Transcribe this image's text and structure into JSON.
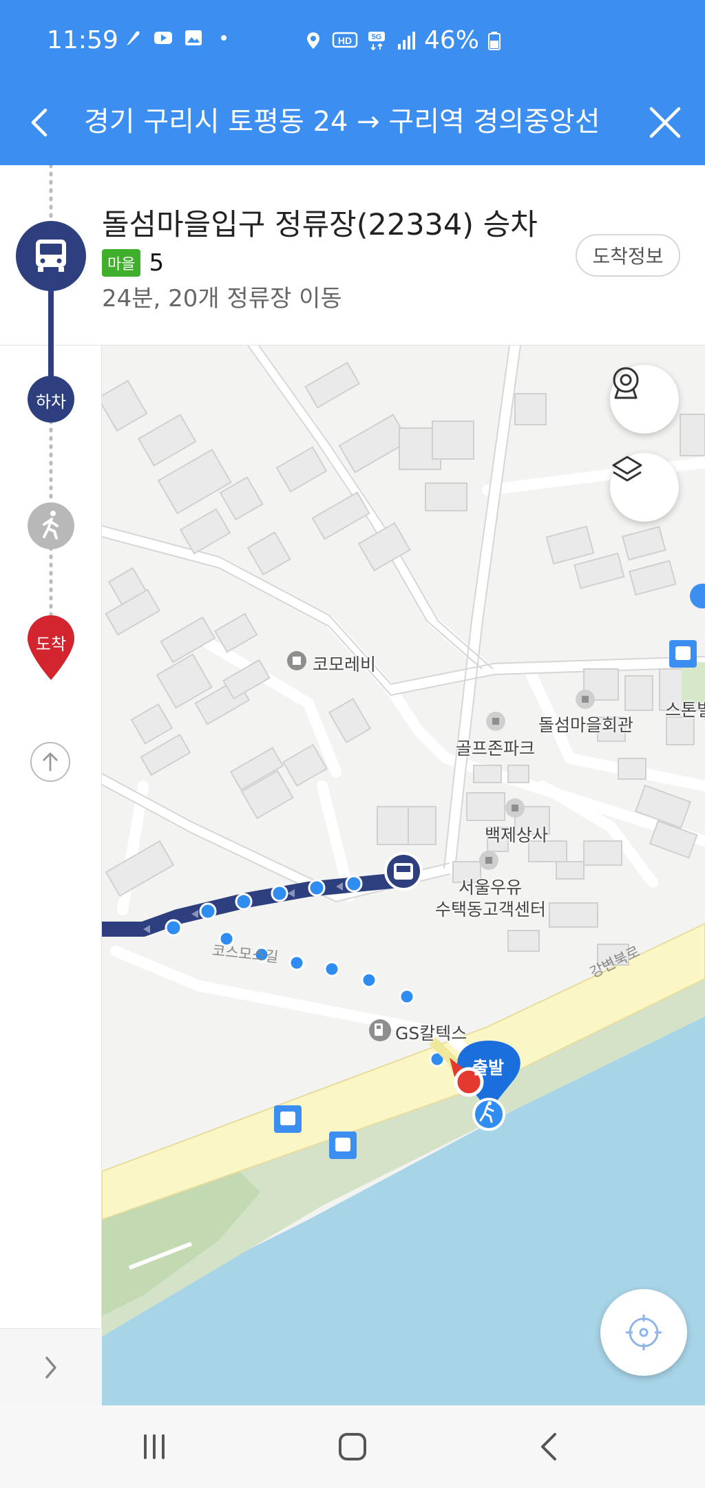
{
  "status_bar": {
    "time": "11:59",
    "battery": "46%",
    "icons": [
      "feather-icon",
      "youtube-icon",
      "gallery-icon",
      "dot-icon",
      "location-icon",
      "hd-icon",
      "5g-icon",
      "signal-icon",
      "battery-icon"
    ]
  },
  "header": {
    "route_title": "경기 구리시 토평동 24 → 구리역 경의중앙선",
    "accent": "#3c8ff0"
  },
  "segment": {
    "stop_title": "돌섬마을입구 정류장(22334) 승차",
    "line_badge": "마을",
    "line_number": "5",
    "trip_info": "24분, 20개 정류장 이동",
    "arrival_button": "도착정보"
  },
  "timeline": {
    "alight_label": "하차",
    "arrive_label": "도착",
    "bus_color": "#2e3f80",
    "arrive_color": "#d3252f"
  },
  "map": {
    "labels": {
      "komorebi": "코모레비",
      "golfzone": "골프존파크",
      "dolseom_hall": "돌섬마을회관",
      "stone": "스톤빌",
      "baekje": "백제상사",
      "seoul_milk_1": "서울우유",
      "seoul_milk_2": "수택동고객센터",
      "gs_caltex": "GS칼텍스",
      "start": "출발"
    },
    "roads": {
      "cosmos": "코스모스길",
      "gangbyeon": "강변북로"
    }
  }
}
